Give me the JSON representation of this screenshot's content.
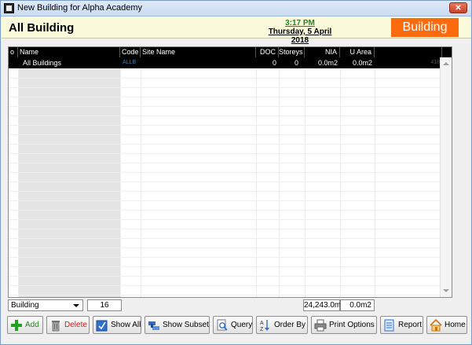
{
  "window": {
    "title": "New Building for Alpha Academy",
    "close_label": "✕"
  },
  "header": {
    "title": "All Building",
    "time": "3:17 PM",
    "date": "Thursday, 5 April 2018",
    "module": "Building",
    "module_color": "#fb6b0e"
  },
  "grid": {
    "columns": [
      {
        "label": "o"
      },
      {
        "label": "Name"
      },
      {
        "label": "Code"
      },
      {
        "label": "Site Name"
      },
      {
        "label": "DOC"
      },
      {
        "label": "Storeys"
      },
      {
        "label": "NIA"
      },
      {
        "label": "U Area"
      },
      {
        "label": ""
      }
    ],
    "rows": [
      {
        "o": "",
        "name": "All Buildings",
        "code": "ALLB",
        "site_name": "",
        "doc": "0",
        "storeys": "0",
        "nia": "0.0m2",
        "u_area": "0.0m2",
        "extra": "418"
      }
    ]
  },
  "status": {
    "filter_value": "Building",
    "count": "16",
    "total_nia": "24,243.0m",
    "total_u_area": "0.0m2"
  },
  "toolbar": {
    "add": "Add",
    "delete": "Delete",
    "show_all": "Show All",
    "show_subset": "Show Subset",
    "query": "Query",
    "order_by": "Order By",
    "print_options": "Print Options",
    "report": "Report",
    "home": "Home"
  },
  "icons": {
    "app": "building-app-icon",
    "add": "plus-icon",
    "delete": "trash-icon",
    "show_all": "checkbox-icon",
    "show_subset": "subset-icon",
    "query": "magnifier-document-icon",
    "order_by": "sort-az-icon",
    "print_options": "printer-icon",
    "report": "document-icon",
    "home": "house-icon"
  }
}
